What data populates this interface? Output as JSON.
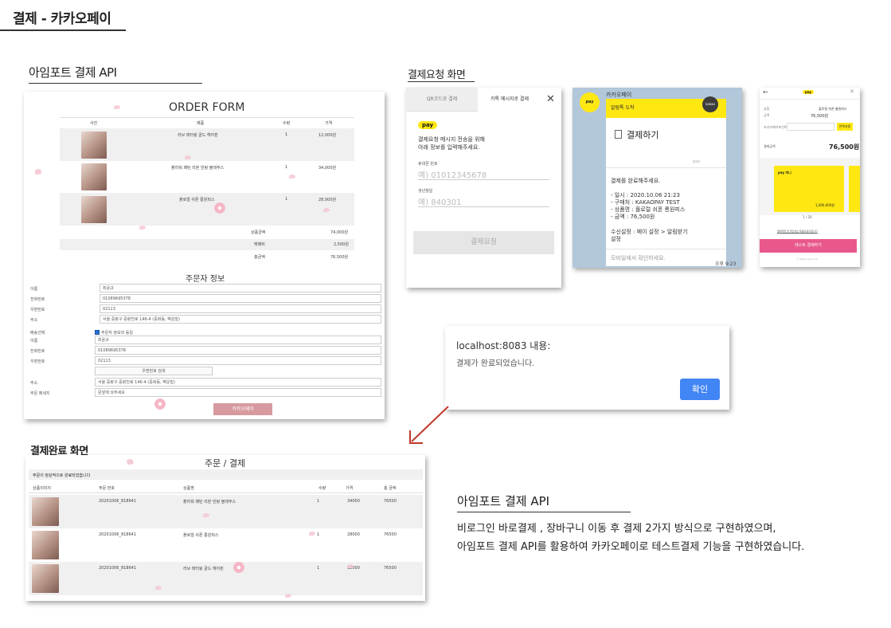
{
  "page_title": "결제 - 카카오페이",
  "sections": {
    "api": "아임포트 결제 API",
    "request": "결제요청 화면",
    "complete": "결제완료 화면"
  },
  "order_form": {
    "title": "ORDER FORM",
    "headers": [
      "사진",
      "제품",
      "수량",
      "가격"
    ],
    "items": [
      {
        "name": "러브 레터링 골드 헤어핀",
        "qty": "1",
        "price": "12,000원"
      },
      {
        "name": "플라워 패턴 리본 빈탕 볼레주스",
        "qty": "1",
        "price": "34,000원"
      },
      {
        "name": "플로럴 쉬폰 롱원피스",
        "qty": "1",
        "price": "28,000원"
      }
    ],
    "summary": [
      {
        "label": "상품금액",
        "value": "74,000원"
      },
      {
        "label": "택배비",
        "value": "2,500원"
      },
      {
        "label": "총금액",
        "value": "76,500원"
      }
    ],
    "orderer_title": "주문자 정보",
    "orderer": [
      {
        "label": "이름",
        "value": "최윤규"
      },
      {
        "label": "전화번호",
        "value": "01089695378"
      },
      {
        "label": "우편번호",
        "value": "02113"
      },
      {
        "label": "주소",
        "value": "서울 중랑구 중랑천로 146-4 (중화동, 벽운빌)"
      }
    ],
    "delivery_label": "배송선택",
    "same_as_orderer": "주문자 정보와 동일",
    "delivery": [
      {
        "label": "이름",
        "value": "최윤규"
      },
      {
        "label": "전화번호",
        "value": "01089695378"
      },
      {
        "label": "우편번호",
        "value": "02113"
      }
    ],
    "zip_search": "우편번호 검색",
    "address": {
      "label": "주소",
      "value": "서울 중랑구 중랑천로 146-4 (중화동, 벽운빌)"
    },
    "message": {
      "label": "주문 메세지",
      "value": "문앞에 놔주세요"
    },
    "pay_button": "카카오페이"
  },
  "kakao_request": {
    "tabs": [
      "QR코드로 결제",
      "카톡 메시지로 결제"
    ],
    "close": "✕",
    "logo": "pay",
    "desc_line1": "결제요청 메시지 전송을 위해",
    "desc_line2": "아래 정보를 입력해주세요.",
    "phone_label": "휴대폰 번호",
    "phone_placeholder": "예) 01012345678",
    "birth_label": "생년월일",
    "birth_placeholder": "예) 840301",
    "request_button": "결제요청"
  },
  "kakao_message": {
    "app": "카카오페이",
    "logo": "pay",
    "badge": "kakao",
    "banner": "알림톡 도착",
    "heading": "결제하기",
    "watermark": "pay",
    "complete": "결제를 완료해주세요.",
    "lines": [
      "- 일시 : 2020.10.06 21:23",
      "- 구매처 : KAKAOPAY TEST",
      "- 상품명 : 플로럴 쉬폰 롱원피스",
      "- 금액 : 76,500원"
    ],
    "setting_line1": "수신설정 : 페이 설정 > 알림받기",
    "setting_line2": "설정",
    "footer": "모바일에서 확인하세요.",
    "time": "오후 9:23"
  },
  "kakao_mobile": {
    "back": "←",
    "logo": "pay",
    "close": "✕",
    "product_label": "상품",
    "product": "플로럴 쉬폰 롱원피스",
    "amount_label": "금액",
    "amount": "76,500원",
    "discount_label": "카카오페이포인트",
    "discount_btn": "전액사용",
    "total_label": "결제금액",
    "total": "76,500원",
    "card_logo": "pay 머니",
    "card_amount": "1,000,000원",
    "pager": "1 / 20",
    "agree": "결제대행 및 개인정보 제공에 동의합니다",
    "pay_button": "테스트 결제하기",
    "copyright": "ⓒ Kakao pay corp."
  },
  "alert": {
    "title": "localhost:8083 내용:",
    "message": "결제가 완료되었습니다.",
    "ok": "확인"
  },
  "complete": {
    "title": "주문 / 결제",
    "notice": "주문이 정상적으로 완료되었습니다",
    "headers": [
      "상품이미지",
      "주문 번호",
      "상품명",
      "수량",
      "가격",
      "총 금액"
    ],
    "rows": [
      {
        "order": "20201006_818641",
        "name": "플라워 패턴 리본 빈탕 볼레주스",
        "qty": "1",
        "price": "34000",
        "total": "76500"
      },
      {
        "order": "20201006_818641",
        "name": "플로럴 쉬폰 롱원피스",
        "qty": "1",
        "price": "28000",
        "total": "76500"
      },
      {
        "order": "20201006_818641",
        "name": "러브 레터링 골드 헤어핀",
        "qty": "1",
        "price": "12000",
        "total": "76500"
      }
    ]
  },
  "description": {
    "title": "아임포트 결제 API",
    "line1": "비로그인 바로결제 , 장바구니 이동 후 결제 2가지 방식으로 구현하였으며,",
    "line2": "아임포트 결제 API를 활용하여 카카오페이로 테스트결제 기능을 구현하였습니다."
  },
  "colors": {
    "kakao_yellow": "#ffe812",
    "pay_button": "#d69a9f",
    "alert_button": "#4285f4",
    "arrow": "#c0392b",
    "chat_bg": "#b2c7da",
    "test_pay": "#e8588c"
  }
}
